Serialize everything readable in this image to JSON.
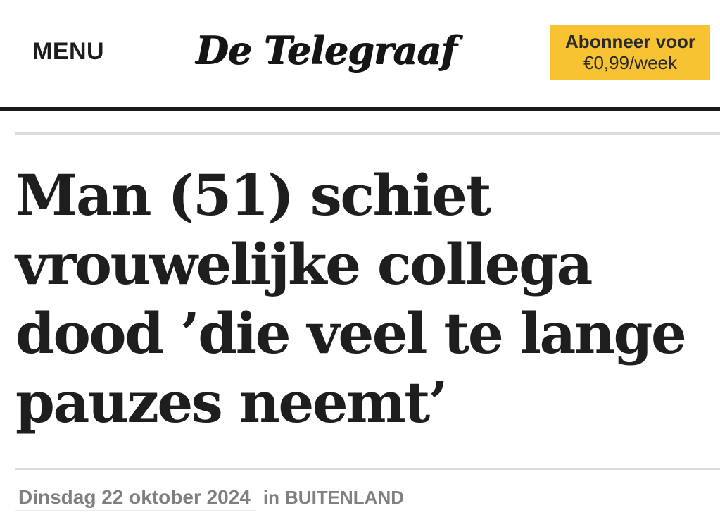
{
  "header": {
    "menu_label": "MENU",
    "logo_text": "De Telegraaf",
    "subscribe": {
      "line1": "Abonneer voor",
      "line2": "€0,99/week"
    }
  },
  "article": {
    "headline": "Man (51) schiet vrouwelijke collega dood ’die veel te lange pauzes neemt’",
    "date": "Dinsdag 22 oktober 2024",
    "in_label": "in",
    "section": "BUITENLAND"
  },
  "colors": {
    "subscribe_bg": "#f8c332",
    "text_dark": "#1e1e1e",
    "meta_gray": "#808080",
    "rule_dark": "#1a1a1a",
    "rule_light": "#dcdcdc"
  }
}
